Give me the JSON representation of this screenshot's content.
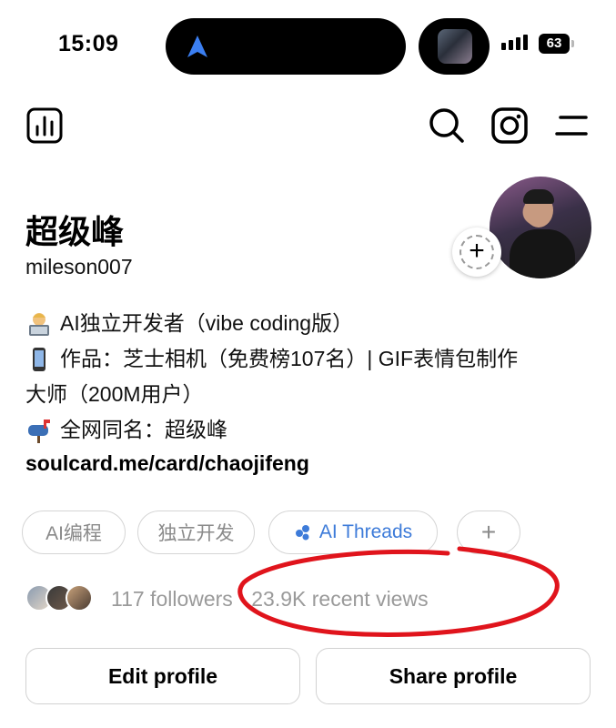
{
  "status_bar": {
    "time": "15:09",
    "battery": "63"
  },
  "profile": {
    "display_name": "超级峰",
    "username": "mileson007",
    "bio_lines": [
      "AI独立开发者（vibe coding版）",
      "作品：芝士相机（免费榜107名）| GIF表情包制作",
      "大师（200M用户）",
      "全网同名：超级峰"
    ],
    "link": "soulcard.me/card/chaojifeng"
  },
  "chips": [
    "AI编程",
    "独立开发",
    "AI Threads",
    "+"
  ],
  "stats": {
    "followers": "117 followers",
    "separator": " · ",
    "views": "23.9K recent views"
  },
  "actions": {
    "edit_profile": "Edit profile",
    "share_profile": "Share profile"
  },
  "icons": [
    "navigation-arrow-icon",
    "insights-icon",
    "search-icon",
    "instagram-icon",
    "menu-icon",
    "plus-icon"
  ],
  "colors": {
    "accent_blue": "#3d7bd9",
    "annotation_red": "#e0141c",
    "muted_text": "#9a9a9a"
  }
}
